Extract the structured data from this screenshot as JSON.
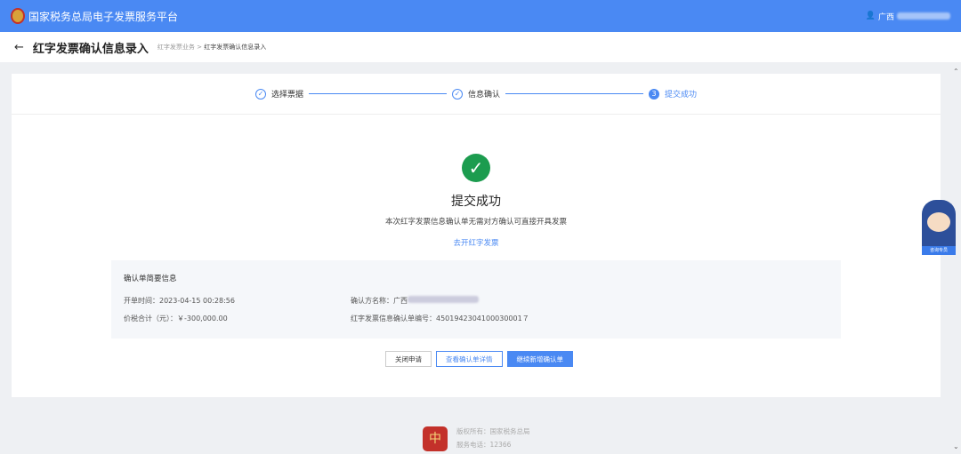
{
  "header": {
    "platform": "国家税务总局电子发票服务平台",
    "user": "广西"
  },
  "subheader": {
    "back": "←",
    "title": "红字发票确认信息录入",
    "breadcrumb_parent": "红字发票业务",
    "breadcrumb_sep": ">",
    "breadcrumb_current": "红字发票确认信息录入"
  },
  "steps": [
    {
      "label": "选择票据",
      "icon": "✓"
    },
    {
      "label": "信息确认",
      "icon": "✓"
    },
    {
      "label": "提交成功",
      "icon": "3"
    }
  ],
  "result": {
    "icon": "✓",
    "title": "提交成功",
    "desc": "本次红字发票信息确认单无需对方确认可直接开具发票",
    "link": "去开红字发票"
  },
  "info": {
    "heading": "确认单简要信息",
    "open_time": "开单时间：2023-04-15 00:28:56",
    "total": "价税合计（元）：￥-300,000.00",
    "party": "确认方名称：广西",
    "number": "红字发票信息确认单编号：4501942304100030001７"
  },
  "buttons": {
    "close": "关闭申请",
    "view": "查看确认单详情",
    "continue": "继续新增确认单"
  },
  "footer": {
    "owner": "版权所有：国家税务总局",
    "phone": "服务电话：12366",
    "logo": "中"
  },
  "assistant": {
    "label": "咨询专员"
  }
}
